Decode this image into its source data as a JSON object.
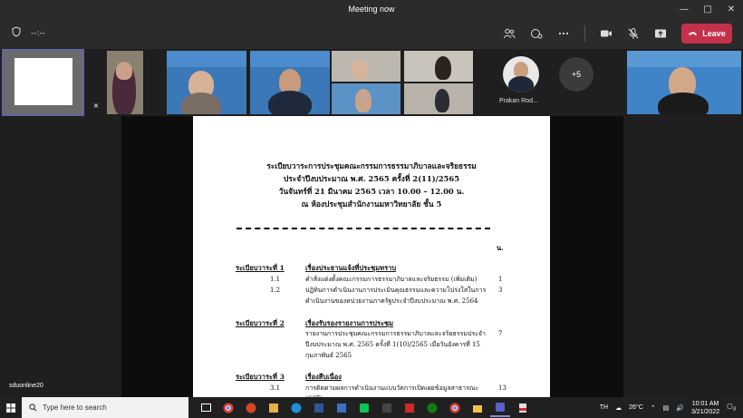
{
  "window": {
    "title": "Meeting now"
  },
  "toolbar": {
    "timer": "--:--",
    "leave_label": "Leave"
  },
  "participants": {
    "overflow_count": "+5",
    "named_tile": "Prakan Rod..."
  },
  "doc": {
    "heading": [
      "ระเบียบวาระการประชุมคณะกรรมการธรรมาภิบาลและจริยธรรม",
      "ประจำปีงบประมาณ พ.ศ. 2565 ครั้งที่ 2(11)/2565",
      "วันจันทร์ที่ 21 มีนาคม 2565  เวลา 10.00 – 12.00 น.",
      "ณ ห้องประชุมสำนักงานมหาวิทยาลัย ชั้น 5"
    ],
    "page_col": "น.",
    "agenda1": {
      "label": "ระเบียบวาระที่ 1",
      "subject": "เรื่องประธานแจ้งที่ประชุมทราบ",
      "items": [
        {
          "num": "1.1",
          "text": "คำสั่งแต่งตั้งคณะกรรมการธรรมาภิบาลและจริยธรรม (เพิ่มเติม)",
          "page": "1"
        },
        {
          "num": "1.2",
          "text": "ปฏิทินการดำเนินงานการประเมินคุณธรรมและความโปร่งใสในการดำเนินงานของหน่วยงานภาครัฐประจำปีงบประมาณ พ.ศ. 2564",
          "page": "3"
        }
      ]
    },
    "agenda2": {
      "label": "ระเบียบวาระที่ 2",
      "subject": "เรื่องรับรองรายงานการประชุม",
      "text": "รายงานการประชุมคณะกรรมการธรรมาภิบาลและจริยธรรมประจำปีงบประมาณ พ.ศ. 2565 ครั้งที่ 1(10)/2565 เมื่อวันอังคารที่ 15 กุมภาพันธ์ 2565",
      "page": "7"
    },
    "agenda3": {
      "label": "ระเบียบวาระที่ 3",
      "subject": "เรื่องสืบเนื่อง",
      "items": [
        {
          "num": "3.1",
          "text": "การติดตามผลการดำเนินงานแบบวัดการเปิดเผยข้อมูลสาธารณะ (OIT)",
          "page": "13"
        }
      ]
    }
  },
  "user_label": "sduonline20",
  "taskbar": {
    "search_placeholder": "Type here to search",
    "weather": "26°C",
    "lang": "TH",
    "time": "10:01 AM",
    "date": "3/21/2022",
    "notif_count": "3"
  },
  "colors": {
    "leave": "#c4314b",
    "accent": "#6264a7"
  }
}
